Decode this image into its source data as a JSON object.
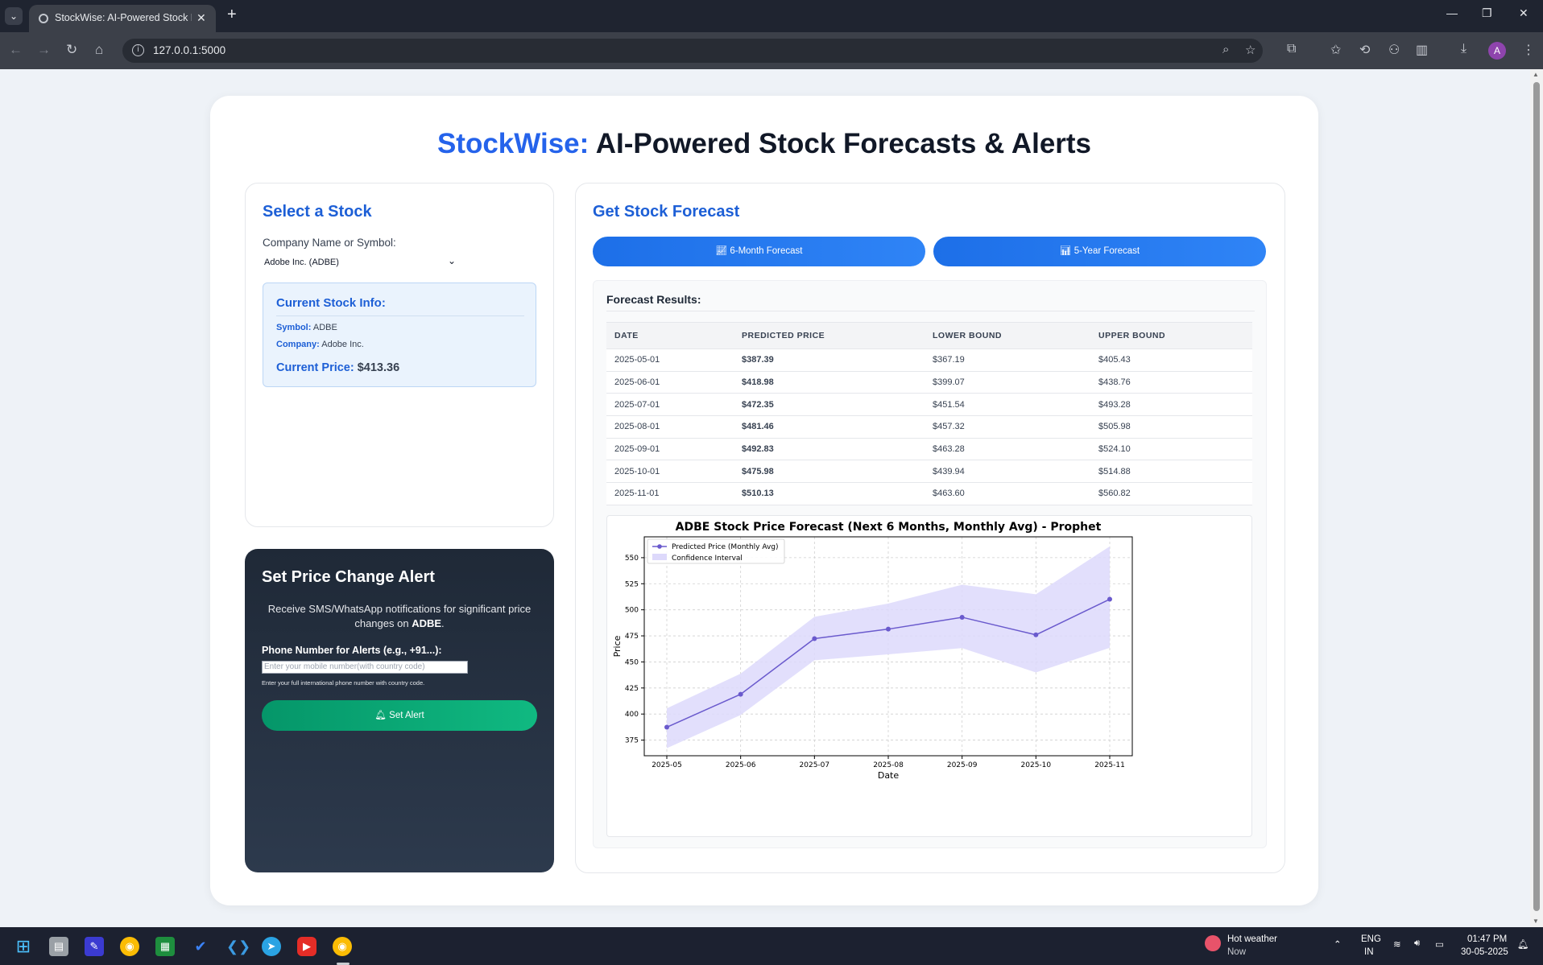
{
  "browser": {
    "tab_title": "StockWise: AI-Powered Stock Fo",
    "url": "127.0.0.1:5000",
    "avatar_letter": "A"
  },
  "header": {
    "brand": "StockWise:",
    "title_rest": " AI-Powered Stock Forecasts & Alerts"
  },
  "select_stock": {
    "heading": "Select a Stock",
    "field_label": "Company Name or Symbol:",
    "selected": "Adobe Inc. (ADBE)",
    "info": {
      "heading": "Current Stock Info:",
      "symbol_label": "Symbol:",
      "symbol": "ADBE",
      "company_label": "Company:",
      "company": "Adobe Inc.",
      "price_label": "Current Price:",
      "price": "$413.36"
    }
  },
  "alert": {
    "heading": "Set Price Change Alert",
    "description_before": "Receive SMS/WhatsApp notifications for significant price changes on ",
    "description_symbol": "ADBE",
    "description_after": ".",
    "phone_label": "Phone Number for Alerts (e.g., +91...):",
    "phone_placeholder": "Enter your mobile number(with country code)",
    "phone_hint": "Enter your full international phone number with country code.",
    "button_label": "Set Alert"
  },
  "forecast": {
    "heading": "Get Stock Forecast",
    "btn_6m": "6-Month Forecast",
    "btn_5y": "5-Year Forecast",
    "results_heading": "Forecast Results:",
    "columns": [
      "DATE",
      "PREDICTED PRICE",
      "LOWER BOUND",
      "UPPER BOUND"
    ],
    "rows": [
      {
        "date": "2025-05-01",
        "predicted": "$387.39",
        "lower": "$367.19",
        "upper": "$405.43",
        "trend": "down"
      },
      {
        "date": "2025-06-01",
        "predicted": "$418.98",
        "lower": "$399.07",
        "upper": "$438.76",
        "trend": "up"
      },
      {
        "date": "2025-07-01",
        "predicted": "$472.35",
        "lower": "$451.54",
        "upper": "$493.28",
        "trend": "up"
      },
      {
        "date": "2025-08-01",
        "predicted": "$481.46",
        "lower": "$457.32",
        "upper": "$505.98",
        "trend": "up"
      },
      {
        "date": "2025-09-01",
        "predicted": "$492.83",
        "lower": "$463.28",
        "upper": "$524.10",
        "trend": "up"
      },
      {
        "date": "2025-10-01",
        "predicted": "$475.98",
        "lower": "$439.94",
        "upper": "$514.88",
        "trend": "up"
      },
      {
        "date": "2025-11-01",
        "predicted": "$510.13",
        "lower": "$463.60",
        "upper": "$560.82",
        "trend": "up"
      }
    ]
  },
  "chart_data": {
    "type": "line",
    "title": "ADBE Stock Price Forecast (Next 6 Months, Monthly Avg) - Prophet",
    "xlabel": "Date",
    "ylabel": "Price",
    "categories": [
      "2025-05",
      "2025-06",
      "2025-07",
      "2025-08",
      "2025-09",
      "2025-10",
      "2025-11"
    ],
    "series": [
      {
        "name": "Predicted Price (Monthly Avg)",
        "values": [
          387.39,
          418.98,
          472.35,
          481.46,
          492.83,
          475.98,
          510.13
        ],
        "color": "#6a5acd"
      }
    ],
    "band": {
      "name": "Confidence Interval",
      "lower": [
        367.19,
        399.07,
        451.54,
        457.32,
        463.28,
        439.94,
        463.6
      ],
      "upper": [
        405.43,
        438.76,
        493.28,
        505.98,
        524.1,
        514.88,
        560.82
      ],
      "color": "#ddd9fb"
    },
    "yticks": [
      375,
      400,
      425,
      450,
      475,
      500,
      525,
      550
    ],
    "ylim": [
      360,
      570
    ],
    "grid": true,
    "legend_position": "top-left"
  },
  "taskbar": {
    "weather_title": "Hot weather",
    "weather_sub": "Now",
    "lang_1": "ENG",
    "lang_2": "IN",
    "time": "01:47 PM",
    "date": "30-05-2025"
  },
  "colors": {
    "brand_blue": "#2563eb",
    "up_green": "#059669",
    "down_red": "#dc2626"
  }
}
